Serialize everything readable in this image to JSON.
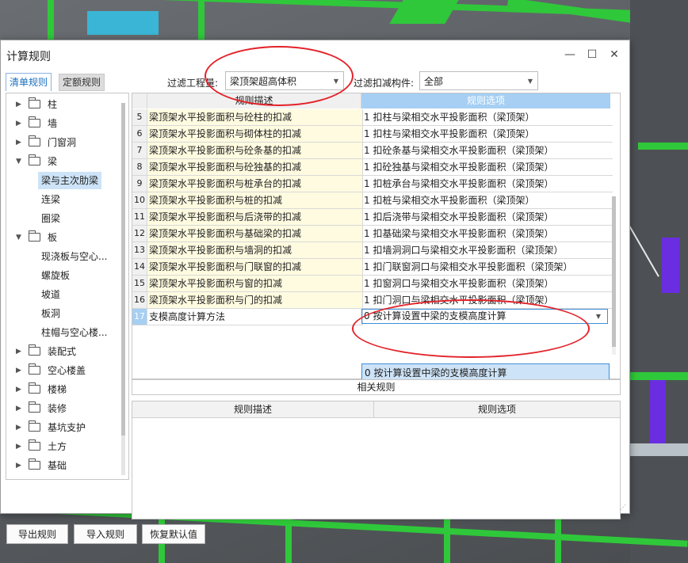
{
  "window": {
    "title": "计算规则",
    "minimize_glyph": "—",
    "maximize_glyph": "☐",
    "close_glyph": "✕"
  },
  "tabs": [
    {
      "label": "清单规则",
      "active": true
    },
    {
      "label": "定额规则",
      "active": false
    }
  ],
  "filters": {
    "project_label": "过滤工程量:",
    "project_value": "梁顶架超高体积",
    "component_label": "过滤扣减构件:",
    "component_value": "全部"
  },
  "tree": {
    "nodes": [
      {
        "label": "柱",
        "expanded": false
      },
      {
        "label": "墙",
        "expanded": false
      },
      {
        "label": "门窗洞",
        "expanded": false
      },
      {
        "label": "梁",
        "expanded": true
      },
      {
        "label": "板",
        "expanded": true
      },
      {
        "label": "装配式",
        "expanded": false
      },
      {
        "label": "空心楼盖",
        "expanded": false
      },
      {
        "label": "楼梯",
        "expanded": false
      },
      {
        "label": "装修",
        "expanded": false
      },
      {
        "label": "基坑支护",
        "expanded": false
      },
      {
        "label": "土方",
        "expanded": false
      },
      {
        "label": "基础",
        "expanded": false
      }
    ],
    "beam_children": [
      "梁与主次肋梁",
      "连梁",
      "圈梁"
    ],
    "slab_children": [
      "现浇板与空心...",
      "螺旋板",
      "坡道",
      "板洞",
      "柱帽与空心楼..."
    ],
    "selected": "梁与主次肋梁"
  },
  "grid": {
    "headers": [
      "规则描述",
      "规则选项"
    ],
    "rows": [
      {
        "num": "5",
        "desc": "梁顶架水平投影面积与砼柱的扣减",
        "opt": "1 扣柱与梁相交水平投影面积（梁顶架）"
      },
      {
        "num": "6",
        "desc": "梁顶架水平投影面积与砌体柱的扣减",
        "opt": "1 扣柱与梁相交水平投影面积（梁顶架）"
      },
      {
        "num": "7",
        "desc": "梁顶架水平投影面积与砼条基的扣减",
        "opt": "1 扣砼条基与梁相交水平投影面积（梁顶架）"
      },
      {
        "num": "8",
        "desc": "梁顶架水平投影面积与砼独基的扣减",
        "opt": "1 扣砼独基与梁相交水平投影面积（梁顶架）"
      },
      {
        "num": "9",
        "desc": "梁顶架水平投影面积与桩承台的扣减",
        "opt": "1 扣桩承台与梁相交水平投影面积（梁顶架）"
      },
      {
        "num": "10",
        "desc": "梁顶架水平投影面积与桩的扣减",
        "opt": "1 扣桩与梁相交水平投影面积（梁顶架）"
      },
      {
        "num": "11",
        "desc": "梁顶架水平投影面积与后浇带的扣减",
        "opt": "1 扣后浇带与梁相交水平投影面积（梁顶架）"
      },
      {
        "num": "12",
        "desc": "梁顶架水平投影面积与基础梁的扣减",
        "opt": "1 扣基础梁与梁相交水平投影面积（梁顶架）"
      },
      {
        "num": "13",
        "desc": "梁顶架水平投影面积与墙洞的扣减",
        "opt": "1 扣墙洞洞口与梁相交水平投影面积（梁顶架）"
      },
      {
        "num": "14",
        "desc": "梁顶架水平投影面积与门联窗的扣减",
        "opt": "1 扣门联窗洞口与梁相交水平投影面积（梁顶架）"
      },
      {
        "num": "15",
        "desc": "梁顶架水平投影面积与窗的扣减",
        "opt": "1 扣窗洞口与梁相交水平投影面积（梁顶架）"
      },
      {
        "num": "16",
        "desc": "梁顶架水平投影面积与门的扣减",
        "opt": "1 扣门洞口与梁相交水平投影面积（梁顶架）"
      },
      {
        "num": "17",
        "desc": "支模高度计算方法",
        "opt": "0 按计算设置中梁的支模高度计算"
      }
    ],
    "dropdown_option": "0 按计算设置中梁的支模高度计算"
  },
  "related": {
    "title": "相关规则",
    "headers": [
      "规则描述",
      "规则选项"
    ]
  },
  "buttons": {
    "export": "导出规则",
    "import": "导入规则",
    "restore": "恢复默认值"
  },
  "colors": {
    "accent": "#1b6fbf",
    "header_blue": "#a6cff3",
    "desc_bg": "#fffbe0",
    "annotation_red": "#e3222a",
    "model_green": "#2fc83a",
    "model_purple": "#6a2ee0"
  }
}
